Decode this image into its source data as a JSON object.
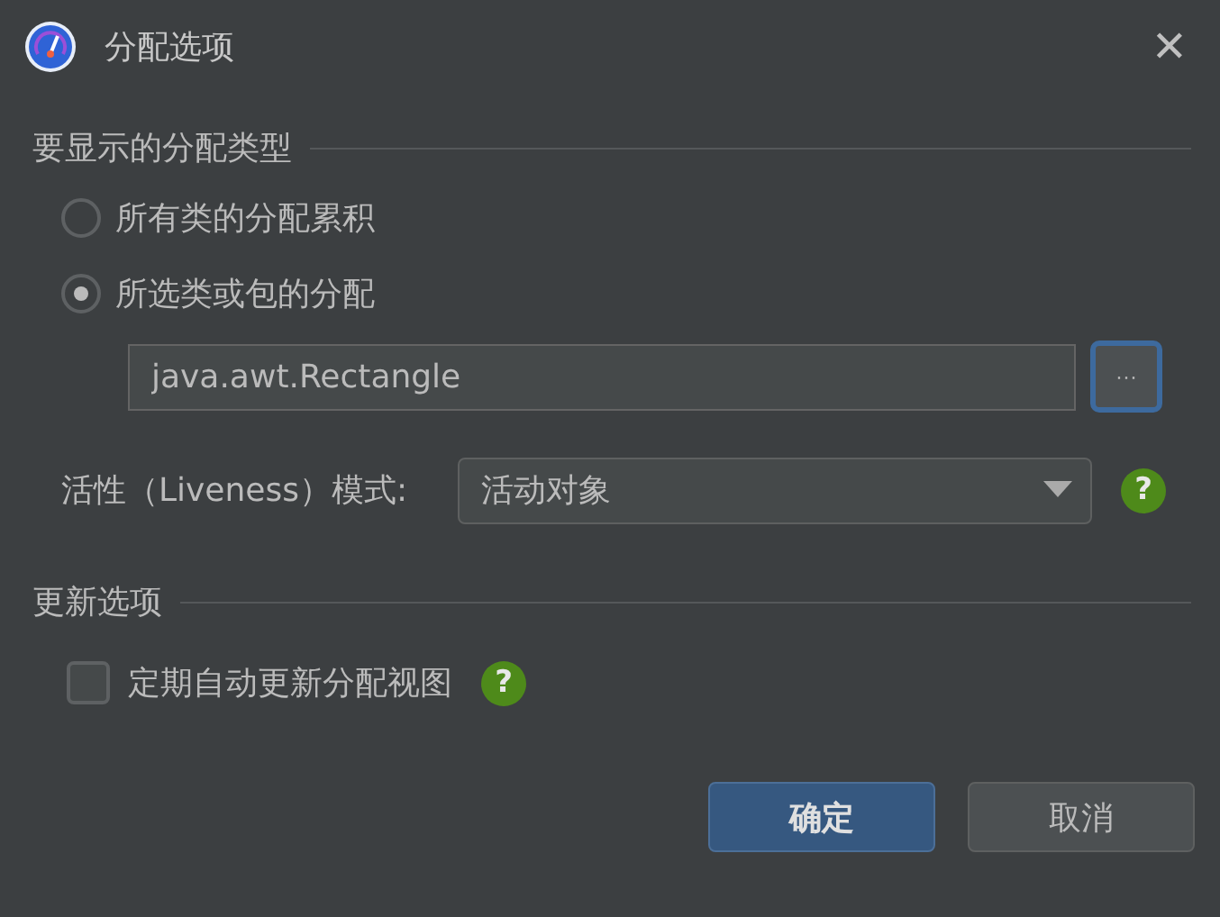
{
  "window": {
    "title": "分配选项",
    "close": "✕"
  },
  "sections": [
    {
      "title": "要显示的分配类型",
      "items": [
        {
          "kind": "radio",
          "label": "所有类的分配累积",
          "selected": false
        },
        {
          "kind": "radio",
          "label": "所选类或包的分配",
          "selected": true
        },
        {
          "kind": "field",
          "value": "java.awt.Rectangle",
          "button": "···"
        },
        {
          "kind": "select",
          "label": "活性（Liveness）模式:",
          "value": "活动对象",
          "help": "?"
        }
      ]
    },
    {
      "title": "更新选项",
      "items": [
        {
          "kind": "checkbox",
          "label": "定期自动更新分配视图",
          "checked": false,
          "help": "?"
        }
      ]
    }
  ],
  "buttons": [
    {
      "label": "确定",
      "default": true
    },
    {
      "label": "取消",
      "default": false
    }
  ]
}
